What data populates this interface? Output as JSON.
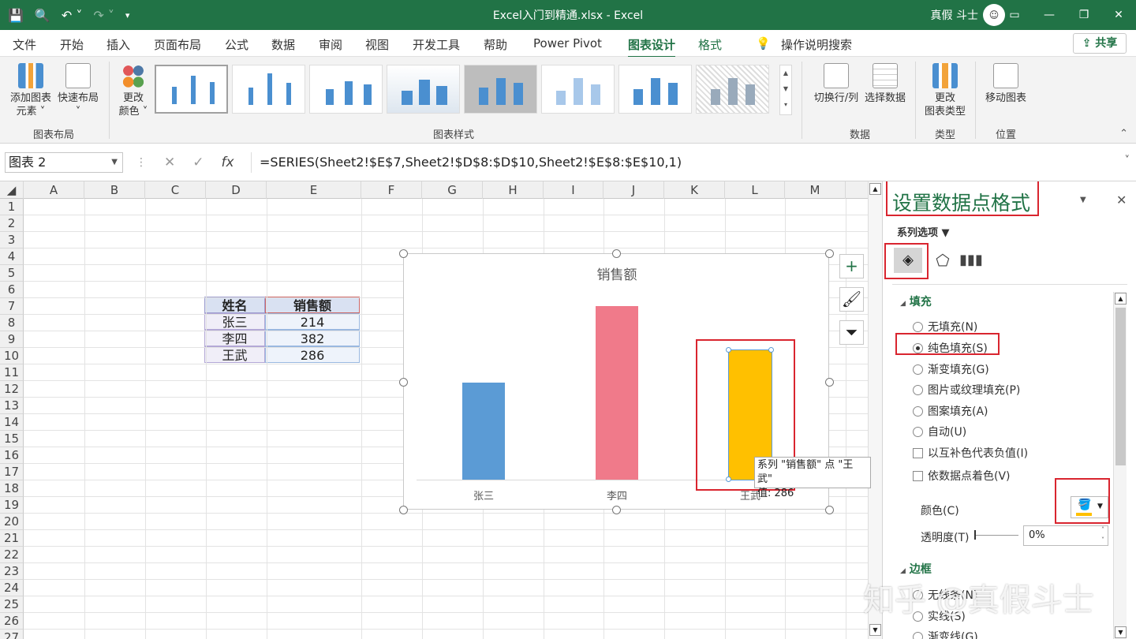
{
  "window": {
    "title": "Excel入门到精通.xlsx  -  Excel",
    "user": "真假 斗士"
  },
  "tabs": [
    "文件",
    "开始",
    "插入",
    "页面布局",
    "公式",
    "数据",
    "审阅",
    "视图",
    "开发工具",
    "帮助",
    "Power Pivot",
    "图表设计",
    "格式"
  ],
  "search": "操作说明搜索",
  "share": "共享",
  "ribbon": {
    "add_element": "添加图表\n元素 ˅",
    "quick_layout": "快速布局\n˅",
    "group_layout": "图表布局",
    "change_colors": "更改\n颜色 ˅",
    "group_styles": "图表样式",
    "switch": "切换行/列",
    "select_data": "选择数据",
    "group_data": "数据",
    "change_type": "更改\n图表类型",
    "group_type": "类型",
    "move_chart": "移动图表",
    "group_location": "位置"
  },
  "formula": {
    "namebox": "图表 2",
    "value": "=SERIES(Sheet2!$E$7,Sheet2!$D$8:$D$10,Sheet2!$E$8:$E$10,1)"
  },
  "columns": [
    "A",
    "B",
    "C",
    "D",
    "E",
    "F",
    "G",
    "H",
    "I",
    "J",
    "K",
    "L",
    "M"
  ],
  "rows": [
    "1",
    "2",
    "3",
    "4",
    "5",
    "6",
    "7",
    "8",
    "9",
    "10",
    "11",
    "12",
    "13",
    "14",
    "15",
    "16",
    "17",
    "18",
    "19",
    "20",
    "21",
    "22",
    "23",
    "24",
    "25",
    "26",
    "27"
  ],
  "table": {
    "header": [
      "姓名",
      "销售额"
    ],
    "rows": [
      [
        "张三",
        "214"
      ],
      [
        "李四",
        "382"
      ],
      [
        "王武",
        "286"
      ]
    ]
  },
  "chart_data": {
    "type": "bar",
    "title": "销售额",
    "categories": [
      "张三",
      "李四",
      "王武"
    ],
    "values": [
      214,
      382,
      286
    ],
    "colors": [
      "#5b9bd5",
      "#f07a8a",
      "#ffc000"
    ],
    "ylim": [
      0,
      400
    ]
  },
  "tooltip": {
    "line1": "系列 \"销售额\" 点 \"王武\"",
    "line2": "值: 286"
  },
  "pane": {
    "title": "设置数据点格式",
    "series_options": "系列选项",
    "fill_header": "填充",
    "fill_options": [
      "无填充(N)",
      "纯色填充(S)",
      "渐变填充(G)",
      "图片或纹理填充(P)",
      "图案填充(A)",
      "自动(U)"
    ],
    "invert": "以互补色代表负值(I)",
    "vary": "依数据点着色(V)",
    "color_label": "颜色(C)",
    "transparency_label": "透明度(T)",
    "transparency_value": "0%",
    "border_header": "边框",
    "border_options": [
      "无线条(N)",
      "实线(S)",
      "渐变线(G)"
    ],
    "fill_color": "#ffc000"
  },
  "watermark": "知乎 @真假斗士"
}
